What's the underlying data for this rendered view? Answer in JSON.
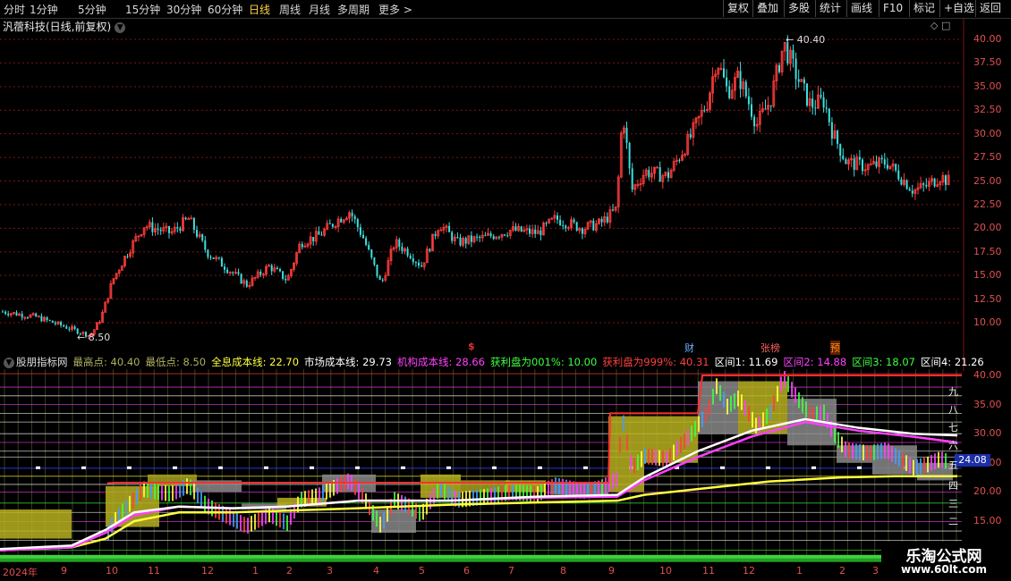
{
  "toolbar": {
    "periods": [
      "分时",
      "1分钟",
      "5分钟",
      "15分钟",
      "30分钟",
      "60分钟",
      "日线",
      "周线",
      "月线",
      "多周期",
      "更多 >"
    ],
    "active_period": "日线",
    "right_buttons": [
      "复权",
      "叠加",
      "多股",
      "统计",
      "画线",
      "F10",
      "标记",
      "+自选",
      "返回"
    ]
  },
  "stock": {
    "title": "汎蓿科技(日线,前复权)"
  },
  "main_chart": {
    "high_label": "40.40",
    "low_label": "8.50",
    "y_ticks": [
      "40.00",
      "37.50",
      "35.00",
      "32.50",
      "30.00",
      "27.50",
      "25.00",
      "22.50",
      "20.00",
      "17.50",
      "15.00",
      "12.50",
      "10.00"
    ],
    "event_markers": [
      {
        "text": "$",
        "color": "#e03030"
      },
      {
        "text": "财",
        "color": "#6ab0ff"
      },
      {
        "text": "张榜",
        "color": "#ff6060"
      },
      {
        "text": "预",
        "color": "#ff9020"
      }
    ]
  },
  "indicator": {
    "name": "股朋指标网",
    "fields": [
      {
        "label": "最高点: 40.40",
        "color": "#b0b060"
      },
      {
        "label": "最低点: 8.50",
        "color": "#b0b060"
      },
      {
        "label": "全息成本线: 22.70",
        "color": "#ffff40"
      },
      {
        "label": "市场成本线: 29.73",
        "color": "#ffffff"
      },
      {
        "label": "机构成本线: 28.66",
        "color": "#ff40ff"
      },
      {
        "label": "获利盘为001%: 10.00",
        "color": "#40ff40"
      },
      {
        "label": "获利盘为999%: 40.31",
        "color": "#ff4040"
      },
      {
        "label": "区间1: 11.69",
        "color": "#ffffff"
      },
      {
        "label": "区间2: 14.88",
        "color": "#ff40ff"
      },
      {
        "label": "区间3: 18.07",
        "color": "#40ff40"
      },
      {
        "label": "区间4: 21.26",
        "color": "#ffffff"
      }
    ],
    "y_ticks": [
      "40.00",
      "35.00",
      "30.00",
      "25.00",
      "20.00",
      "15.00"
    ],
    "current_price": "24.08",
    "zone_labels": [
      "九",
      "八",
      "七",
      "六",
      "五",
      "四",
      "三",
      "二"
    ]
  },
  "dates": [
    "2024年",
    "9",
    "10",
    "11",
    "12",
    "1",
    "2",
    "3",
    "4",
    "5",
    "6",
    "7",
    "8",
    "9",
    "10",
    "11",
    "12",
    "1",
    "2",
    "3"
  ],
  "watermark": {
    "line1": "乐淘公式网",
    "line2": "www.60lt.com"
  }
}
